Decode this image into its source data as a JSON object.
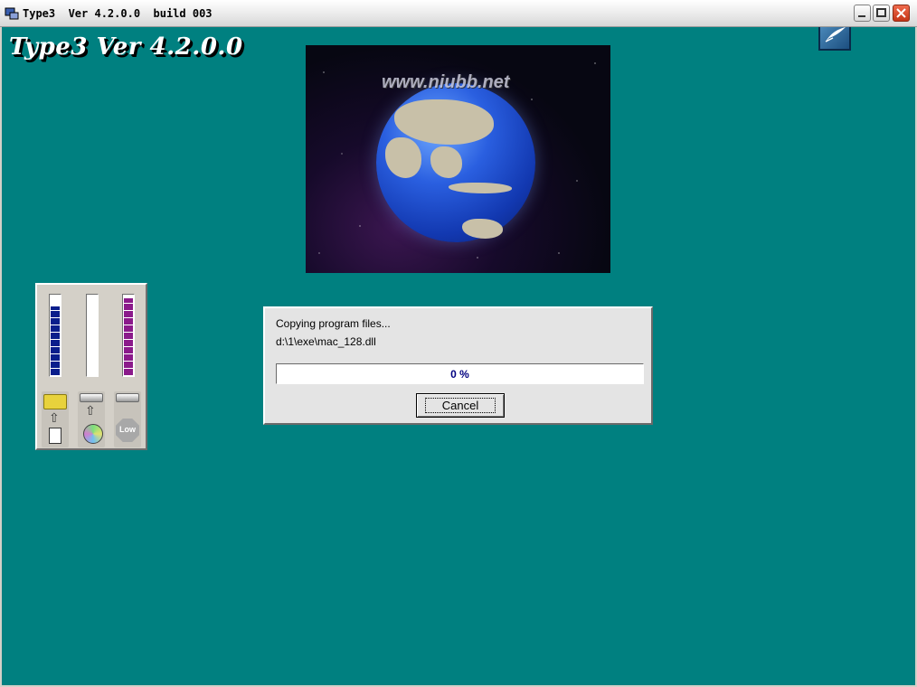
{
  "window": {
    "title": "Type3  Ver 4.2.0.0  build 003",
    "icon": "app-icon",
    "controls": [
      "minimize-icon",
      "maximize-icon",
      "close-icon"
    ]
  },
  "app": {
    "heading": "Type3 Ver 4.2.0.0",
    "corner_logo": "feather-logo-icon",
    "background_color": "#008080"
  },
  "splash": {
    "watermark": "www.niubb.net",
    "image": "globe-image"
  },
  "meters": [
    {
      "name": "meter-1",
      "color": "#0a1e8c",
      "level": 0.85,
      "icons": [
        "folder-icon",
        "arrow-up-icon",
        "document-icon"
      ]
    },
    {
      "name": "meter-2",
      "color": "#ffffff",
      "level": 0.0,
      "icons": [
        "drive-icon",
        "arrow-up-icon",
        "cd-icon"
      ]
    },
    {
      "name": "meter-3",
      "color": "#8b1a8b",
      "level": 0.95,
      "icons": [
        "drive-icon",
        "low-stop-icon"
      ]
    }
  ],
  "meter_low_label": "Low",
  "dialog": {
    "message": "Copying program files...",
    "path": "d:\\1\\exe\\mac_128.dll",
    "progress_text": "0 %",
    "progress": 0,
    "cancel_label": "Cancel"
  }
}
